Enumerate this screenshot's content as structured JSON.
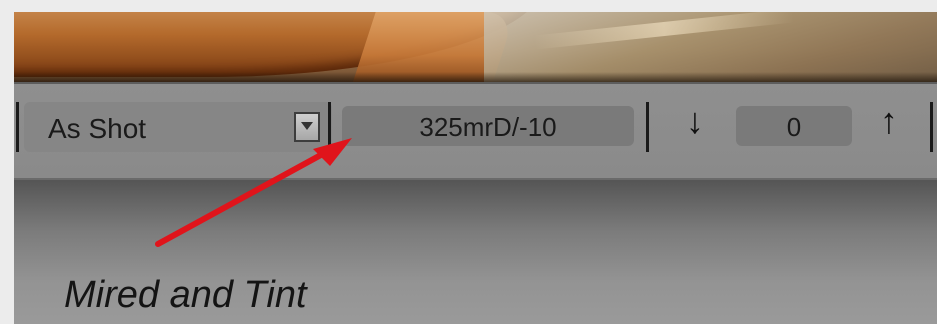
{
  "white_balance": {
    "preset_label": "As Shot",
    "mired_tint_value": "325mrD/-10",
    "down_icon": "down-arrow-icon",
    "step_value": "0",
    "up_icon": "up-arrow-icon"
  },
  "annotation": {
    "caption": "Mired and Tint",
    "arrow_color": "#e0141b"
  }
}
